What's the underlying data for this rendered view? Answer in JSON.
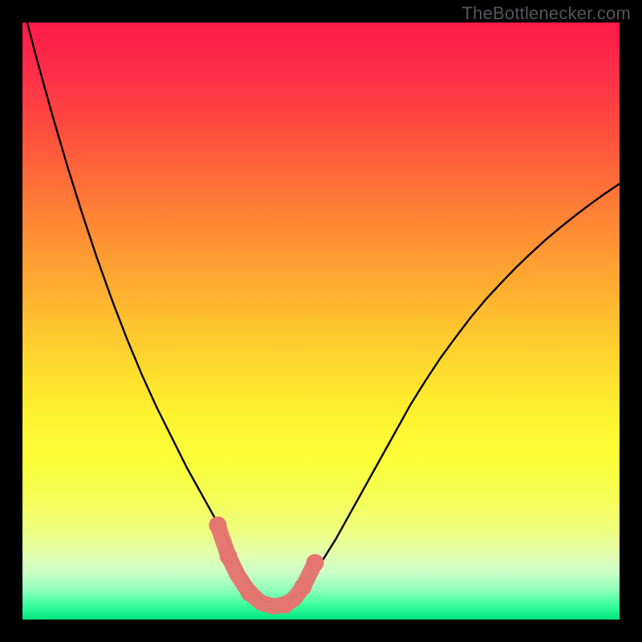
{
  "watermark": "TheBottlenecker.com",
  "chart_data": {
    "type": "line",
    "title": "",
    "xlabel": "",
    "ylabel": "",
    "xlim": [
      0,
      1
    ],
    "ylim": [
      0,
      1
    ],
    "x": [
      0.0,
      0.025,
      0.05,
      0.075,
      0.1,
      0.125,
      0.15,
      0.175,
      0.2,
      0.225,
      0.25,
      0.275,
      0.3,
      0.325,
      0.34,
      0.35,
      0.36,
      0.37,
      0.38,
      0.39,
      0.4,
      0.41,
      0.42,
      0.43,
      0.44,
      0.45,
      0.475,
      0.5,
      0.525,
      0.55,
      0.575,
      0.6,
      0.625,
      0.65,
      0.675,
      0.7,
      0.725,
      0.75,
      0.775,
      0.8,
      0.825,
      0.85,
      0.875,
      0.9,
      0.925,
      0.95,
      0.975,
      1.0
    ],
    "values": [
      1.03,
      0.935,
      0.845,
      0.76,
      0.68,
      0.605,
      0.535,
      0.47,
      0.41,
      0.355,
      0.305,
      0.255,
      0.21,
      0.165,
      0.14,
      0.12,
      0.1,
      0.08,
      0.06,
      0.045,
      0.035,
      0.03,
      0.028,
      0.028,
      0.03,
      0.035,
      0.06,
      0.095,
      0.135,
      0.18,
      0.225,
      0.27,
      0.315,
      0.36,
      0.4,
      0.438,
      0.472,
      0.505,
      0.535,
      0.562,
      0.588,
      0.612,
      0.635,
      0.656,
      0.676,
      0.695,
      0.713,
      0.73
    ],
    "markers": {
      "x": [
        0.327,
        0.345,
        0.36,
        0.38,
        0.4,
        0.42,
        0.44,
        0.455,
        0.47,
        0.49
      ],
      "y": [
        0.158,
        0.106,
        0.075,
        0.045,
        0.028,
        0.022,
        0.025,
        0.035,
        0.055,
        0.095
      ]
    },
    "gradient_stops": [
      {
        "offset": 0.0,
        "color": "#ff1a4a"
      },
      {
        "offset": 0.08,
        "color": "#ff2d49"
      },
      {
        "offset": 0.18,
        "color": "#ff4d3e"
      },
      {
        "offset": 0.3,
        "color": "#ff7a36"
      },
      {
        "offset": 0.42,
        "color": "#ffa531"
      },
      {
        "offset": 0.55,
        "color": "#ffd22e"
      },
      {
        "offset": 0.66,
        "color": "#fff32f"
      },
      {
        "offset": 0.74,
        "color": "#fbff3a"
      },
      {
        "offset": 0.8,
        "color": "#f5ff58"
      },
      {
        "offset": 0.85,
        "color": "#eeff7e"
      },
      {
        "offset": 0.89,
        "color": "#e4ffad"
      },
      {
        "offset": 0.92,
        "color": "#cdffc8"
      },
      {
        "offset": 0.95,
        "color": "#8fffba"
      },
      {
        "offset": 0.975,
        "color": "#3dffa0"
      },
      {
        "offset": 1.0,
        "color": "#00e57e"
      }
    ],
    "colors": {
      "curve": "#000000",
      "marker_fill": "#e5756f",
      "marker_stroke": "#d85a56"
    }
  }
}
